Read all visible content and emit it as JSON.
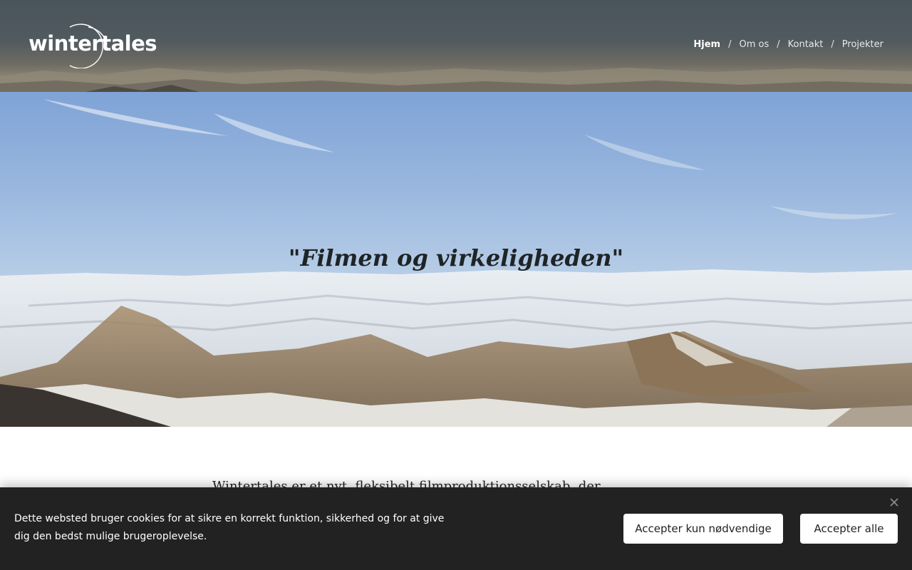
{
  "header": {
    "logo_text": "wintertales",
    "nav": [
      {
        "label": "Hjem",
        "active": true
      },
      {
        "label": "Om os",
        "active": false
      },
      {
        "label": "Kontakt",
        "active": false
      },
      {
        "label": "Projekter",
        "active": false
      }
    ],
    "separator": "/"
  },
  "hero": {
    "title": "\"Filmen og virkeligheden\""
  },
  "intro": {
    "text": "Wintertales er et nyt, fleksibelt filmproduktionsselskab, der..."
  },
  "cookie_banner": {
    "text": "Dette websted bruger cookies for at sikre en korrekt funktion, sikkerhed og for at give dig den bedst mulige brugeroplevelse.",
    "accept_necessary_label": "Accepter kun nødvendige",
    "accept_all_label": "Accepter alle",
    "close_icon": "close-icon"
  },
  "colors": {
    "cookie_bg": "#222222",
    "nav_text": "#e6e9ec",
    "hero_title": "#1e2426"
  }
}
